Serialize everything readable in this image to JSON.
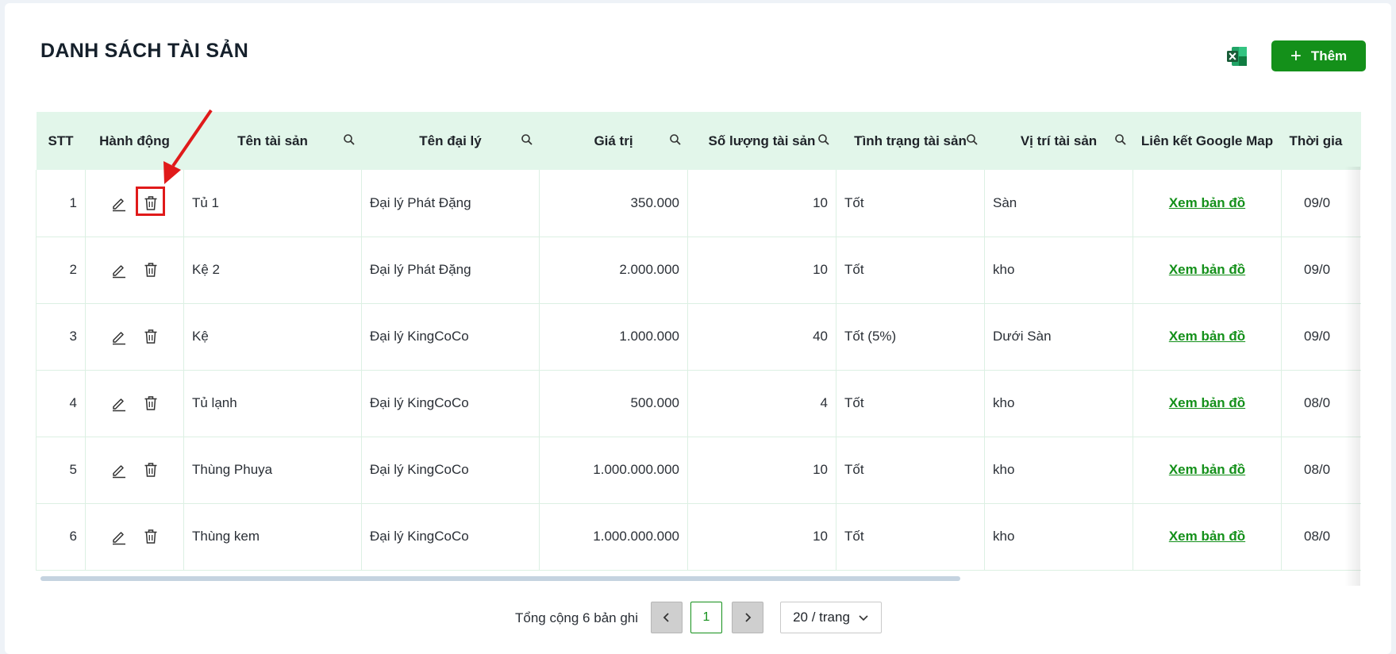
{
  "page": {
    "title": "DANH SÁCH TÀI SẢN"
  },
  "toolbar": {
    "add_label": "Thêm",
    "excel_icon": "excel-icon"
  },
  "table": {
    "columns": [
      {
        "label": "STT",
        "searchable": false
      },
      {
        "label": "Hành động",
        "searchable": false
      },
      {
        "label": "Tên tài sản",
        "searchable": true
      },
      {
        "label": "Tên đại lý",
        "searchable": true
      },
      {
        "label": "Giá trị",
        "searchable": true
      },
      {
        "label": "Số lượng tài sản",
        "searchable": true
      },
      {
        "label": "Tình trạng tài sản",
        "searchable": true
      },
      {
        "label": "Vị trí tài sản",
        "searchable": true
      },
      {
        "label": "Liên kết Google Map",
        "searchable": false
      },
      {
        "label": "Thời gia",
        "searchable": false
      }
    ],
    "map_link_label": "Xem bản đồ",
    "rows": [
      {
        "stt": "1",
        "name": "Tủ 1",
        "agency": "Đại lý Phát Đặng",
        "value": "350.000",
        "quantity": "10",
        "status": "Tốt",
        "location": "Sàn",
        "time": "09/0"
      },
      {
        "stt": "2",
        "name": "Kệ 2",
        "agency": "Đại lý Phát Đặng",
        "value": "2.000.000",
        "quantity": "10",
        "status": "Tốt",
        "location": "kho",
        "time": "09/0"
      },
      {
        "stt": "3",
        "name": "Kệ",
        "agency": "Đại lý KingCoCo",
        "value": "1.000.000",
        "quantity": "40",
        "status": "Tốt (5%)",
        "location": "Dưới Sàn",
        "time": "09/0"
      },
      {
        "stt": "4",
        "name": "Tủ lạnh",
        "agency": "Đại lý KingCoCo",
        "value": "500.000",
        "quantity": "4",
        "status": "Tốt",
        "location": "kho",
        "time": "08/0"
      },
      {
        "stt": "5",
        "name": "Thùng Phuya",
        "agency": "Đại lý KingCoCo",
        "value": "1.000.000.000",
        "quantity": "10",
        "status": "Tốt",
        "location": "kho",
        "time": "08/0"
      },
      {
        "stt": "6",
        "name": "Thùng kem",
        "agency": "Đại lý KingCoCo",
        "value": "1.000.000.000",
        "quantity": "10",
        "status": "Tốt",
        "location": "kho",
        "time": "08/0"
      }
    ]
  },
  "pagination": {
    "total_text": "Tổng cộng 6 bản ghi",
    "current_page": "1",
    "page_size": "20 / trang"
  },
  "colors": {
    "accent": "#14901a",
    "header_bg": "#e2f6ea",
    "highlight": "#e01a1a"
  }
}
